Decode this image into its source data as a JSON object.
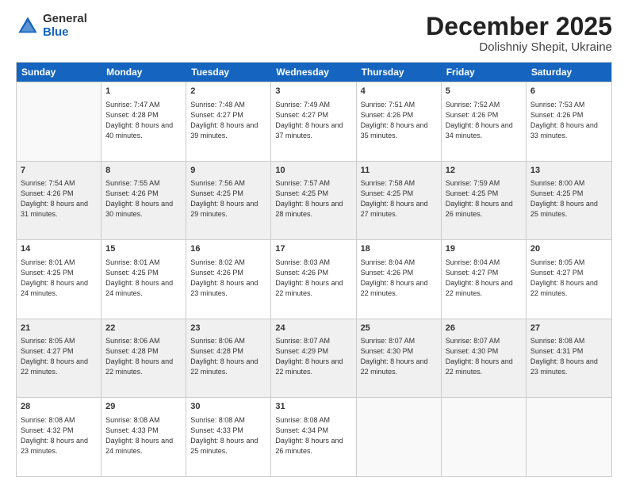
{
  "logo": {
    "general": "General",
    "blue": "Blue"
  },
  "header": {
    "month": "December 2025",
    "location": "Dolishniy Shepit, Ukraine"
  },
  "weekdays": [
    "Sunday",
    "Monday",
    "Tuesday",
    "Wednesday",
    "Thursday",
    "Friday",
    "Saturday"
  ],
  "rows": [
    [
      {
        "day": "",
        "empty": true
      },
      {
        "day": "1",
        "sunrise": "Sunrise: 7:47 AM",
        "sunset": "Sunset: 4:28 PM",
        "daylight": "Daylight: 8 hours and 40 minutes."
      },
      {
        "day": "2",
        "sunrise": "Sunrise: 7:48 AM",
        "sunset": "Sunset: 4:27 PM",
        "daylight": "Daylight: 8 hours and 39 minutes."
      },
      {
        "day": "3",
        "sunrise": "Sunrise: 7:49 AM",
        "sunset": "Sunset: 4:27 PM",
        "daylight": "Daylight: 8 hours and 37 minutes."
      },
      {
        "day": "4",
        "sunrise": "Sunrise: 7:51 AM",
        "sunset": "Sunset: 4:26 PM",
        "daylight": "Daylight: 8 hours and 35 minutes."
      },
      {
        "day": "5",
        "sunrise": "Sunrise: 7:52 AM",
        "sunset": "Sunset: 4:26 PM",
        "daylight": "Daylight: 8 hours and 34 minutes."
      },
      {
        "day": "6",
        "sunrise": "Sunrise: 7:53 AM",
        "sunset": "Sunset: 4:26 PM",
        "daylight": "Daylight: 8 hours and 33 minutes."
      }
    ],
    [
      {
        "day": "7",
        "sunrise": "Sunrise: 7:54 AM",
        "sunset": "Sunset: 4:26 PM",
        "daylight": "Daylight: 8 hours and 31 minutes."
      },
      {
        "day": "8",
        "sunrise": "Sunrise: 7:55 AM",
        "sunset": "Sunset: 4:26 PM",
        "daylight": "Daylight: 8 hours and 30 minutes."
      },
      {
        "day": "9",
        "sunrise": "Sunrise: 7:56 AM",
        "sunset": "Sunset: 4:25 PM",
        "daylight": "Daylight: 8 hours and 29 minutes."
      },
      {
        "day": "10",
        "sunrise": "Sunrise: 7:57 AM",
        "sunset": "Sunset: 4:25 PM",
        "daylight": "Daylight: 8 hours and 28 minutes."
      },
      {
        "day": "11",
        "sunrise": "Sunrise: 7:58 AM",
        "sunset": "Sunset: 4:25 PM",
        "daylight": "Daylight: 8 hours and 27 minutes."
      },
      {
        "day": "12",
        "sunrise": "Sunrise: 7:59 AM",
        "sunset": "Sunset: 4:25 PM",
        "daylight": "Daylight: 8 hours and 26 minutes."
      },
      {
        "day": "13",
        "sunrise": "Sunrise: 8:00 AM",
        "sunset": "Sunset: 4:25 PM",
        "daylight": "Daylight: 8 hours and 25 minutes."
      }
    ],
    [
      {
        "day": "14",
        "sunrise": "Sunrise: 8:01 AM",
        "sunset": "Sunset: 4:25 PM",
        "daylight": "Daylight: 8 hours and 24 minutes."
      },
      {
        "day": "15",
        "sunrise": "Sunrise: 8:01 AM",
        "sunset": "Sunset: 4:25 PM",
        "daylight": "Daylight: 8 hours and 24 minutes."
      },
      {
        "day": "16",
        "sunrise": "Sunrise: 8:02 AM",
        "sunset": "Sunset: 4:26 PM",
        "daylight": "Daylight: 8 hours and 23 minutes."
      },
      {
        "day": "17",
        "sunrise": "Sunrise: 8:03 AM",
        "sunset": "Sunset: 4:26 PM",
        "daylight": "Daylight: 8 hours and 22 minutes."
      },
      {
        "day": "18",
        "sunrise": "Sunrise: 8:04 AM",
        "sunset": "Sunset: 4:26 PM",
        "daylight": "Daylight: 8 hours and 22 minutes."
      },
      {
        "day": "19",
        "sunrise": "Sunrise: 8:04 AM",
        "sunset": "Sunset: 4:27 PM",
        "daylight": "Daylight: 8 hours and 22 minutes."
      },
      {
        "day": "20",
        "sunrise": "Sunrise: 8:05 AM",
        "sunset": "Sunset: 4:27 PM",
        "daylight": "Daylight: 8 hours and 22 minutes."
      }
    ],
    [
      {
        "day": "21",
        "sunrise": "Sunrise: 8:05 AM",
        "sunset": "Sunset: 4:27 PM",
        "daylight": "Daylight: 8 hours and 22 minutes."
      },
      {
        "day": "22",
        "sunrise": "Sunrise: 8:06 AM",
        "sunset": "Sunset: 4:28 PM",
        "daylight": "Daylight: 8 hours and 22 minutes."
      },
      {
        "day": "23",
        "sunrise": "Sunrise: 8:06 AM",
        "sunset": "Sunset: 4:28 PM",
        "daylight": "Daylight: 8 hours and 22 minutes."
      },
      {
        "day": "24",
        "sunrise": "Sunrise: 8:07 AM",
        "sunset": "Sunset: 4:29 PM",
        "daylight": "Daylight: 8 hours and 22 minutes."
      },
      {
        "day": "25",
        "sunrise": "Sunrise: 8:07 AM",
        "sunset": "Sunset: 4:30 PM",
        "daylight": "Daylight: 8 hours and 22 minutes."
      },
      {
        "day": "26",
        "sunrise": "Sunrise: 8:07 AM",
        "sunset": "Sunset: 4:30 PM",
        "daylight": "Daylight: 8 hours and 22 minutes."
      },
      {
        "day": "27",
        "sunrise": "Sunrise: 8:08 AM",
        "sunset": "Sunset: 4:31 PM",
        "daylight": "Daylight: 8 hours and 23 minutes."
      }
    ],
    [
      {
        "day": "28",
        "sunrise": "Sunrise: 8:08 AM",
        "sunset": "Sunset: 4:32 PM",
        "daylight": "Daylight: 8 hours and 23 minutes."
      },
      {
        "day": "29",
        "sunrise": "Sunrise: 8:08 AM",
        "sunset": "Sunset: 4:33 PM",
        "daylight": "Daylight: 8 hours and 24 minutes."
      },
      {
        "day": "30",
        "sunrise": "Sunrise: 8:08 AM",
        "sunset": "Sunset: 4:33 PM",
        "daylight": "Daylight: 8 hours and 25 minutes."
      },
      {
        "day": "31",
        "sunrise": "Sunrise: 8:08 AM",
        "sunset": "Sunset: 4:34 PM",
        "daylight": "Daylight: 8 hours and 26 minutes."
      },
      {
        "day": "",
        "empty": true
      },
      {
        "day": "",
        "empty": true
      },
      {
        "day": "",
        "empty": true
      }
    ]
  ]
}
